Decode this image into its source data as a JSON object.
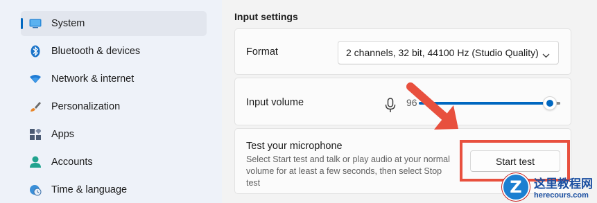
{
  "sidebar": {
    "items": [
      {
        "label": "System",
        "icon": "system-icon",
        "selected": true
      },
      {
        "label": "Bluetooth & devices",
        "icon": "bluetooth-icon"
      },
      {
        "label": "Network & internet",
        "icon": "wifi-icon"
      },
      {
        "label": "Personalization",
        "icon": "brush-icon"
      },
      {
        "label": "Apps",
        "icon": "apps-icon"
      },
      {
        "label": "Accounts",
        "icon": "account-icon"
      },
      {
        "label": "Time & language",
        "icon": "globe-clock-icon"
      }
    ]
  },
  "input_settings": {
    "title": "Input settings",
    "format": {
      "label": "Format",
      "selected": "2 channels, 32 bit, 44100 Hz (Studio Quality)"
    },
    "volume": {
      "label": "Input volume",
      "value": "96",
      "level_percent": 96
    },
    "test": {
      "title": "Test your microphone",
      "description": "Select Start test and talk or play audio at your normal volume for at least a few seconds, then select Stop test",
      "button_label": "Start test"
    }
  },
  "watermark": {
    "text": "这里教程网",
    "url": "herecours.com",
    "logo_letter": "Z"
  },
  "colors": {
    "accent": "#0067c0",
    "annotation": "#e8503e"
  }
}
